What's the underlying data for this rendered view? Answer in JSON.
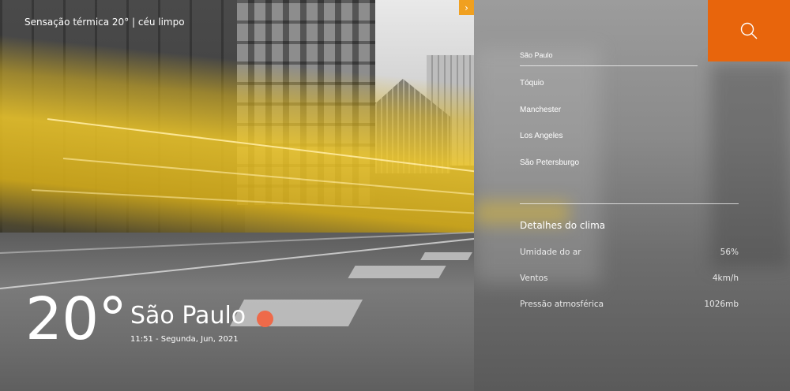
{
  "hero": {
    "feels_like": "Sensação térmica 20° | céu limpo",
    "temperature": "20°",
    "city": "São Paulo",
    "datetime": "11:51 - Segunda, Jun, 2021",
    "arrow_icon": "chevron-right-icon"
  },
  "search": {
    "value": "São Paulo",
    "placeholder": "",
    "icon": "search-icon"
  },
  "cities": [
    "Tóquio",
    "Manchester",
    "Los Angeles",
    "São Petersburgo"
  ],
  "details": {
    "title": "Detalhes do clima",
    "rows": [
      {
        "label": "Umidade do ar",
        "value": "56%"
      },
      {
        "label": "Ventos",
        "value": "4km/h"
      },
      {
        "label": "Pressão atmosférica",
        "value": "1026mb"
      }
    ]
  },
  "colors": {
    "accent": "#e8650c",
    "dot": "#ee6a4a",
    "tab": "#f0a020"
  }
}
